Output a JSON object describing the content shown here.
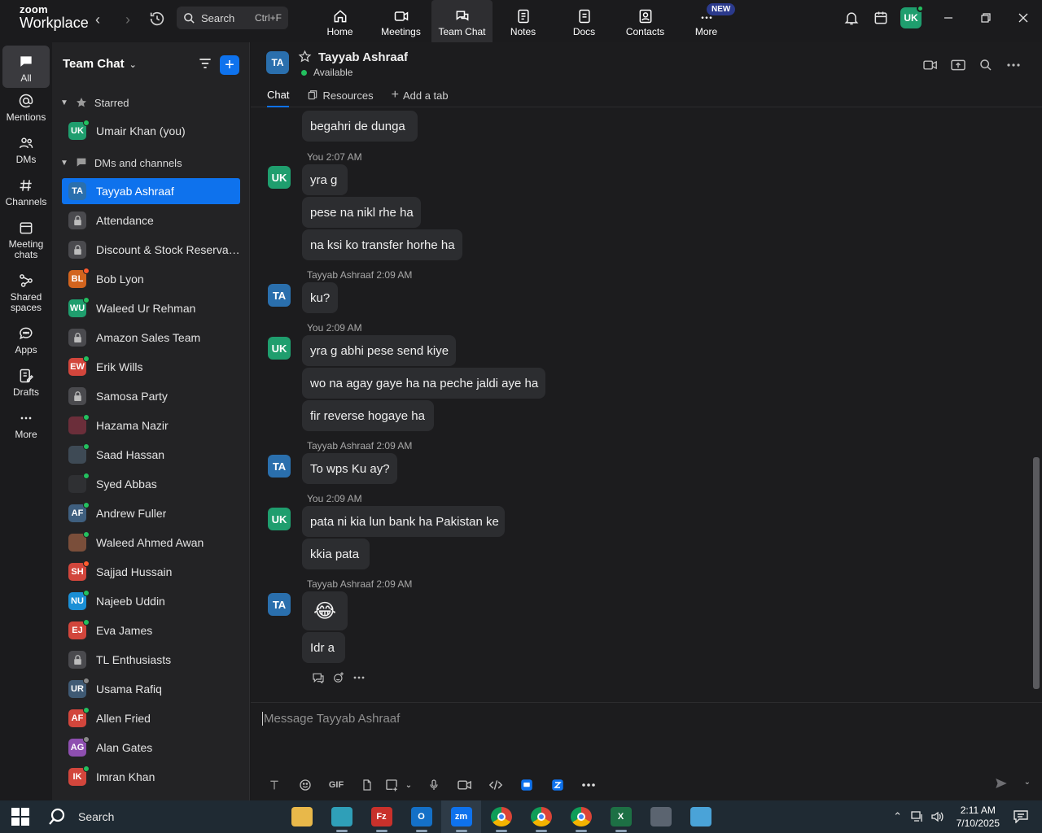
{
  "brand": {
    "line1": "zoom",
    "line2": "Workplace"
  },
  "search": {
    "label": "Search",
    "shortcut": "Ctrl+F"
  },
  "nav": [
    {
      "label": "Home",
      "icon": "home-icon"
    },
    {
      "label": "Meetings",
      "icon": "video-camera-icon"
    },
    {
      "label": "Team Chat",
      "icon": "chat-bubbles-icon"
    },
    {
      "label": "Notes",
      "icon": "notes-icon"
    },
    {
      "label": "Docs",
      "icon": "docs-icon"
    },
    {
      "label": "Contacts",
      "icon": "contacts-icon"
    },
    {
      "label": "More",
      "icon": "more-dots-icon",
      "badge": "NEW"
    }
  ],
  "user_initials": "UK",
  "rail": [
    {
      "label": "All"
    },
    {
      "label": "Mentions"
    },
    {
      "label": "DMs"
    },
    {
      "label": "Channels"
    },
    {
      "label": "Meeting chats"
    },
    {
      "label": "Shared spaces"
    },
    {
      "label": "Apps"
    },
    {
      "label": "Drafts"
    },
    {
      "label": "More"
    }
  ],
  "sidebar": {
    "title": "Team Chat",
    "starred_label": "Starred",
    "dms_label": "DMs and channels",
    "starred": [
      {
        "initials": "UK",
        "name": "Umair Khan (you)",
        "color": "#1f9e6e",
        "status": "#23c05f"
      }
    ],
    "items": [
      {
        "initials": "TA",
        "name": "Tayyab Ashraaf",
        "color": "#2a6fad",
        "status": ""
      },
      {
        "initials": "",
        "name": "Attendance",
        "color": "#4a4a4e",
        "status": "",
        "lock": true
      },
      {
        "initials": "",
        "name": "Discount & Stock Reservati...",
        "color": "#4a4a4e",
        "status": "",
        "lock": true
      },
      {
        "initials": "BL",
        "name": "Bob Lyon",
        "color": "#d2641e",
        "status": "#ff5b2e"
      },
      {
        "initials": "WU",
        "name": "Waleed Ur Rehman",
        "color": "#1f9e6e",
        "status": "#23c05f"
      },
      {
        "initials": "",
        "name": "Amazon Sales Team",
        "color": "#4a4a4e",
        "status": "",
        "lock": true
      },
      {
        "initials": "EW",
        "name": "Erik Wills",
        "color": "#d2463c",
        "status": "#23c05f"
      },
      {
        "initials": "",
        "name": "Samosa Party",
        "color": "#4a4a4e",
        "status": "",
        "lock": true
      },
      {
        "initials": "",
        "name": "Hazama Nazir",
        "color": "#6b2e3a",
        "status": "#23c05f"
      },
      {
        "initials": "",
        "name": "Saad Hassan",
        "color": "#3e4a55",
        "status": "#23c05f"
      },
      {
        "initials": "",
        "name": "Syed Abbas",
        "color": "#2f3033",
        "status": "#23c05f"
      },
      {
        "initials": "AF",
        "name": "Andrew Fuller",
        "color": "#3f5f7f",
        "status": "#23c05f"
      },
      {
        "initials": "",
        "name": "Waleed Ahmed Awan",
        "color": "#7a4e3a",
        "status": "#23c05f"
      },
      {
        "initials": "SH",
        "name": "Sajjad Hussain",
        "color": "#d2463c",
        "status": "#ff5b2e"
      },
      {
        "initials": "NU",
        "name": "Najeeb Uddin",
        "color": "#1a8fd6",
        "status": "#23c05f"
      },
      {
        "initials": "EJ",
        "name": "Eva James",
        "color": "#d2463c",
        "status": "#23c05f"
      },
      {
        "initials": "",
        "name": "TL Enthusiasts",
        "color": "#4a4a4e",
        "status": "",
        "lock": true
      },
      {
        "initials": "UR",
        "name": "Usama Rafiq",
        "color": "#3f5a74",
        "status": "#8a8a8a"
      },
      {
        "initials": "AF",
        "name": "Allen Fried",
        "color": "#d2463c",
        "status": "#23c05f"
      },
      {
        "initials": "AG",
        "name": "Alan Gates",
        "color": "#8e4fb0",
        "status": "#8a8a8a"
      },
      {
        "initials": "IK",
        "name": "Imran Khan",
        "color": "#d2463c",
        "status": "#23c05f"
      }
    ]
  },
  "chat": {
    "contact_initials": "TA",
    "contact_name": "Tayyab Ashraaf",
    "status": "Available",
    "tabs": [
      "Chat",
      "Resources",
      "Add a tab"
    ],
    "composer_placeholder": "Message Tayyab Ashraaf",
    "gif_label": "GIF",
    "groups": [
      {
        "author": "",
        "time": "",
        "initials": "",
        "messages": [
          "begahri de dunga"
        ]
      },
      {
        "author": "You",
        "time": "2:07 AM",
        "initials": "UK",
        "messages": [
          "yra g",
          "pese na nikl rhe ha",
          "na ksi ko transfer horhe ha"
        ]
      },
      {
        "author": "Tayyab Ashraaf",
        "time": "2:09 AM",
        "initials": "TA",
        "messages": [
          "ku?"
        ]
      },
      {
        "author": "You",
        "time": "2:09 AM",
        "initials": "UK",
        "messages": [
          "yra g abhi pese send kiye",
          "wo na agay gaye ha na peche jaldi aye ha",
          "fir reverse hogaye ha"
        ]
      },
      {
        "author": "Tayyab Ashraaf",
        "time": "2:09 AM",
        "initials": "TA",
        "messages": [
          "To wps Ku ay?"
        ]
      },
      {
        "author": "You",
        "time": "2:09 AM",
        "initials": "UK",
        "messages": [
          "pata ni kia lun bank ha Pakistan ke",
          "kkia pata"
        ]
      },
      {
        "author": "Tayyab Ashraaf",
        "time": "2:09 AM",
        "initials": "TA",
        "messages": [
          "😂",
          "Idr a"
        ]
      }
    ]
  },
  "taskbar": {
    "search_label": "Search",
    "time": "2:11 AM",
    "date": "7/10/2025",
    "apps": [
      {
        "name": "file-explorer-icon",
        "color": "#e8b84a",
        "text": ""
      },
      {
        "name": "app-icon",
        "color": "#2f9fb8",
        "text": ""
      },
      {
        "name": "filezilla-icon",
        "color": "#c8312b",
        "text": "Fz"
      },
      {
        "name": "outlook-icon",
        "color": "#1470c7",
        "text": "O"
      },
      {
        "name": "zoom-icon",
        "color": "#0e72ed",
        "text": "zm"
      },
      {
        "name": "chrome-icon",
        "color": "#db4437",
        "text": ""
      },
      {
        "name": "chrome-icon",
        "color": "#db4437",
        "text": ""
      },
      {
        "name": "chrome-icon",
        "color": "#db4437",
        "text": ""
      },
      {
        "name": "excel-icon",
        "color": "#1d7044",
        "text": "X"
      },
      {
        "name": "calculator-icon",
        "color": "#5b6470",
        "text": ""
      },
      {
        "name": "app-icon",
        "color": "#4aa3d8",
        "text": ""
      }
    ]
  }
}
